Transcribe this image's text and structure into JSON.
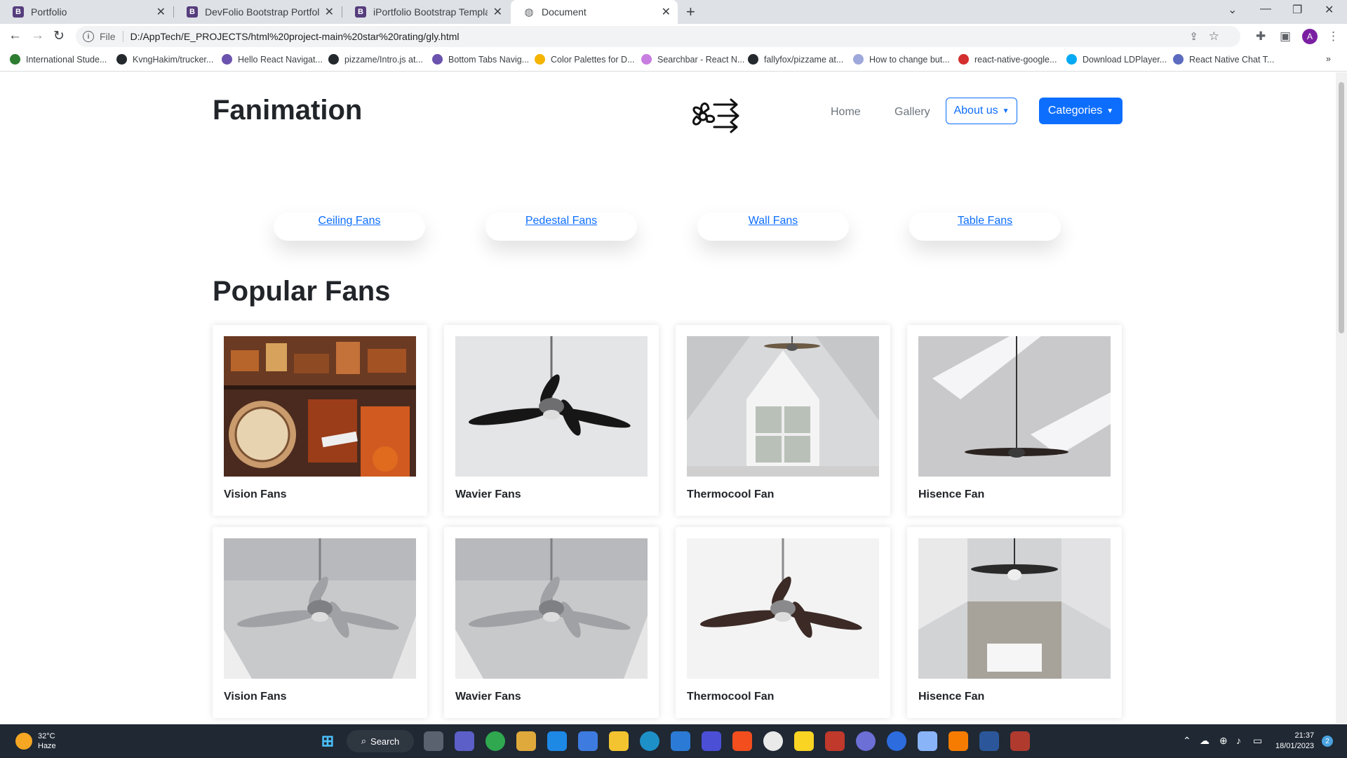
{
  "browser": {
    "tabs": [
      {
        "title": "Portfolio",
        "icon": "bootstrap-icon"
      },
      {
        "title": "DevFolio Bootstrap Portfolio Tem",
        "icon": "bootstrap-icon"
      },
      {
        "title": "iPortfolio Bootstrap Template - In",
        "icon": "bootstrap-icon"
      },
      {
        "title": "Document",
        "icon": "globe-icon",
        "active": true
      }
    ],
    "address": {
      "scheme": "File",
      "url": "D:/AppTech/E_PROJECTS/html%20project-main%20star%20rating/gly.html"
    },
    "profile_initial": "A",
    "bookmarks": [
      {
        "label": "International Stude...",
        "color": "#2e7d32"
      },
      {
        "label": "KvngHakim/trucker...",
        "color": "#24292e"
      },
      {
        "label": "Hello React Navigat...",
        "color": "#6b52ae"
      },
      {
        "label": "pizzame/Intro.js at...",
        "color": "#24292e"
      },
      {
        "label": "Bottom Tabs Navig...",
        "color": "#6b52ae"
      },
      {
        "label": "Color Palettes for D...",
        "color": "#f4b400"
      },
      {
        "label": "Searchbar - React N...",
        "color": "#c87de0"
      },
      {
        "label": "fallyfox/pizzame at...",
        "color": "#24292e"
      },
      {
        "label": "How to change but...",
        "color": "#9fa8da"
      },
      {
        "label": "react-native-google...",
        "color": "#d32f2f"
      },
      {
        "label": "Download LDPlayer...",
        "color": "#03a9f4"
      },
      {
        "label": "React Native Chat T...",
        "color": "#5c6bc0"
      }
    ]
  },
  "page": {
    "brand": "Fanimation",
    "nav": {
      "home": "Home",
      "gallery": "Gallery",
      "about": "About us",
      "categories": "Categories"
    },
    "category_links": [
      "Ceiling Fans",
      "Pedestal Fans",
      "Wall Fans",
      "Table Fans"
    ],
    "section_title": "Popular Fans",
    "products": [
      {
        "name": "Vision Fans",
        "image": "vintage-shop"
      },
      {
        "name": "Wavier Fans",
        "image": "ceiling-fan-closeup"
      },
      {
        "name": "Thermocool Fan",
        "image": "attic-room-fan"
      },
      {
        "name": "Hisence Fan",
        "image": "skylight-fan"
      },
      {
        "name": "Vision Fans",
        "image": "white-ceiling-fan"
      },
      {
        "name": "Wavier Fans",
        "image": "white-ceiling-fan"
      },
      {
        "name": "Thermocool Fan",
        "image": "dark-blade-fan"
      },
      {
        "name": "Hisence Fan",
        "image": "vaulted-room-fan"
      }
    ]
  },
  "taskbar": {
    "weather_temp": "32°C",
    "weather_desc": "Haze",
    "search_label": "Search",
    "time": "21:37",
    "date": "18/01/2023",
    "notifications": "2"
  }
}
